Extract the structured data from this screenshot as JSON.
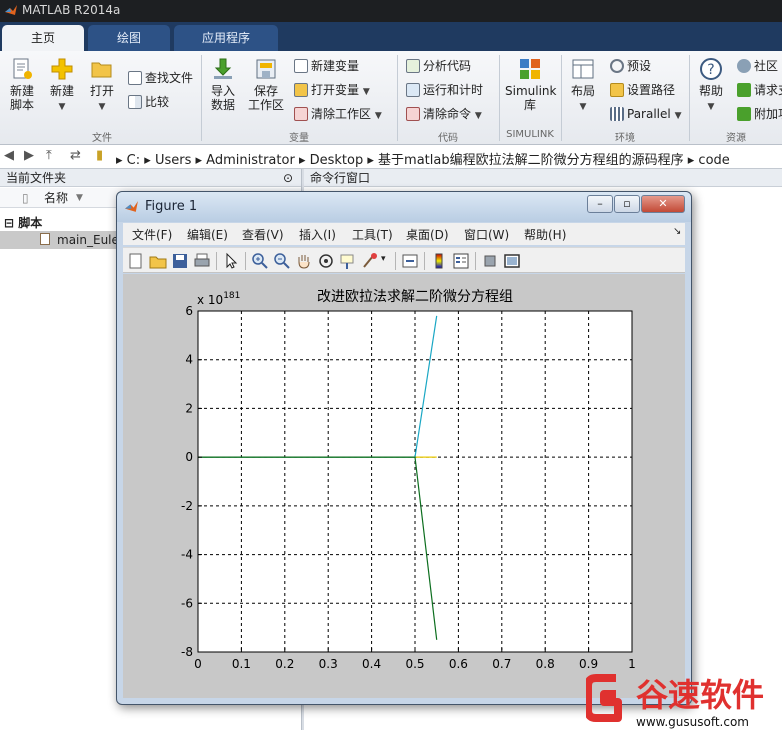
{
  "app": {
    "title": "MATLAB R2014a"
  },
  "tabs": [
    {
      "label": "主页",
      "active": true
    },
    {
      "label": "绘图",
      "active": false
    },
    {
      "label": "应用程序",
      "active": false
    }
  ],
  "ribbon": {
    "file_group": "文件",
    "new_script": [
      "新建",
      "脚本"
    ],
    "new": "新建",
    "open": "打开",
    "find_files": "查找文件",
    "compare": "比较",
    "variable_group": "变量",
    "import_data": [
      "导入",
      "数据"
    ],
    "save_workspace": [
      "保存",
      "工作区"
    ],
    "new_variable": "新建变量",
    "open_variable": "打开变量",
    "clear_workspace": "清除工作区",
    "code_group": "代码",
    "analyze_code": "分析代码",
    "run_and_time": "运行和计时",
    "clear_commands": "清除命令",
    "simulink_group": "SIMULINK",
    "simulink_library": [
      "Simulink",
      "库"
    ],
    "environment_group": "环境",
    "layout": "布局",
    "preferences": "预设",
    "set_path": "设置路径",
    "parallel": "Parallel",
    "resources_group": "资源",
    "help": "帮助",
    "community": "社区",
    "request_support": "请求支",
    "addons": "附加功"
  },
  "address": {
    "crumbs": [
      "C:",
      "Users",
      "Administrator",
      "Desktop",
      "基于matlab编程欧拉法解二阶微分方程组的源码程序",
      "code"
    ]
  },
  "left_panel": {
    "title": "当前文件夹",
    "column_name": "名称",
    "group": "脚本",
    "file": "main_Euler"
  },
  "right_panel": {
    "title": "命令行窗口"
  },
  "figure": {
    "title": "Figure 1",
    "menu": [
      "文件(F)",
      "编辑(E)",
      "查看(V)",
      "插入(I)",
      "工具(T)",
      "桌面(D)",
      "窗口(W)",
      "帮助(H)"
    ]
  },
  "chart_data": {
    "type": "line",
    "title": "改进欧拉法求解二阶微分方程组",
    "xlim": [
      0,
      1
    ],
    "ylim": [
      -8,
      6
    ],
    "x_ticks": [
      "0",
      "0.1",
      "0.2",
      "0.3",
      "0.4",
      "0.5",
      "0.6",
      "0.7",
      "0.8",
      "0.9",
      "1"
    ],
    "y_ticks": [
      "-8",
      "-6",
      "-4",
      "-2",
      "0",
      "2",
      "4",
      "6"
    ],
    "y_exponent_base": "x 10",
    "y_exponent": "181",
    "grid": true,
    "grid_style": "dashed",
    "series": [
      {
        "color": "#e8c800",
        "x": [
          0,
          0.5,
          0.55
        ],
        "y": [
          0,
          0,
          0
        ]
      },
      {
        "color": "#1aa7c4",
        "x": [
          0,
          0.5,
          0.55
        ],
        "y": [
          0,
          0,
          5.8
        ]
      },
      {
        "color": "#0c6e1e",
        "x": [
          0,
          0.5,
          0.55
        ],
        "y": [
          0,
          0,
          -7.5
        ]
      }
    ]
  },
  "watermark": {
    "brand": "谷速软件",
    "url": "www.gususoft.com",
    "color": "#e0312f"
  }
}
